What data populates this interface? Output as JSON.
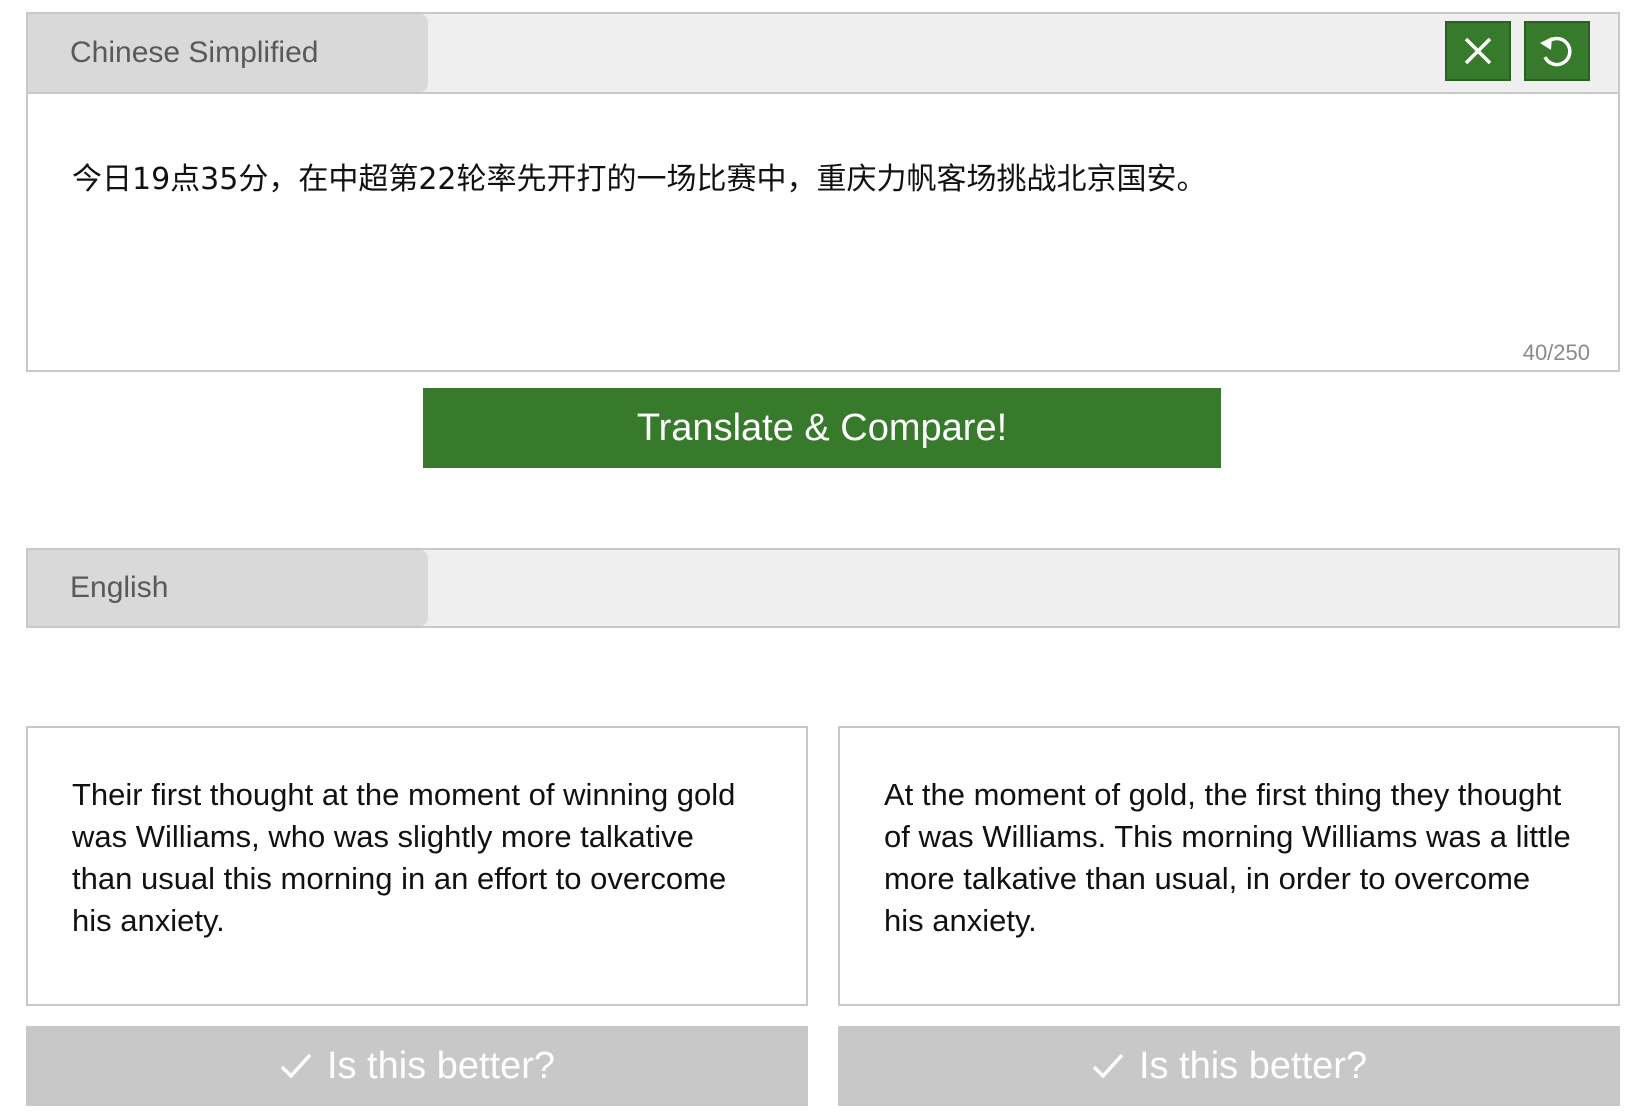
{
  "source": {
    "language": "Chinese Simplified",
    "text": "今日19点35分，在中超第22轮率先开打的一场比赛中，重庆力帆客场挑战北京国安。",
    "char_count": "40/250",
    "clear_icon": "close-icon",
    "reset_icon": "undo-icon"
  },
  "translate_button": {
    "label": "Translate & Compare!"
  },
  "target": {
    "language": "English"
  },
  "results": [
    {
      "text": "Their first thought at the moment of winning gold was Williams, who was slightly more talkative than usual this morning in an effort to overcome his anxiety.",
      "vote_label": "Is this better?"
    },
    {
      "text": "At the moment of gold, the first thing they thought of was Williams. This morning Williams was a little more talkative than usual, in order to overcome his anxiety.",
      "vote_label": "Is this better?"
    }
  ],
  "colors": {
    "accent": "#387a2b",
    "panel_header": "#efefef",
    "lang_select": "#d9d9d9",
    "vote_button": "#c8c8c8"
  }
}
